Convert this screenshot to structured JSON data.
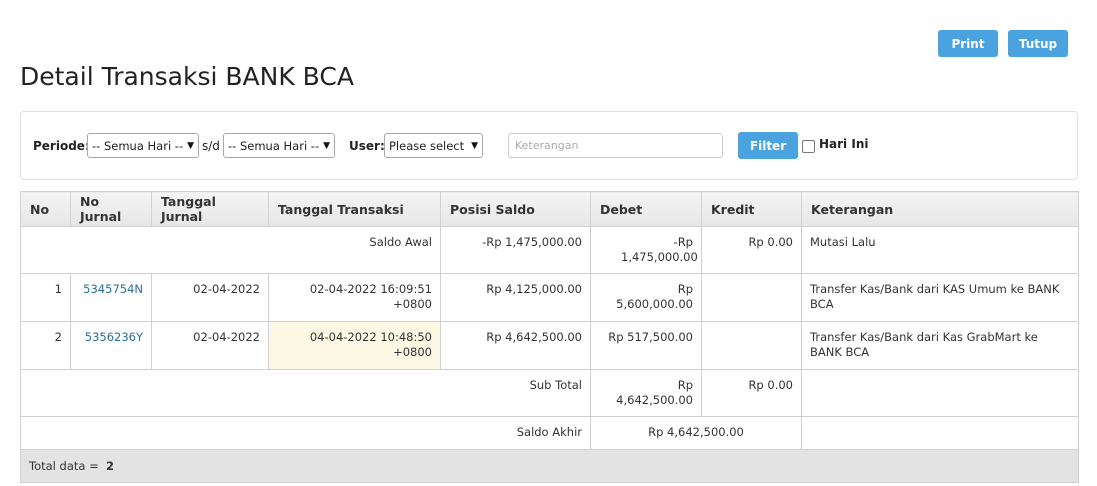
{
  "header": {
    "title": "Detail Transaksi BANK BCA",
    "print_label": "Print",
    "close_label": "Tutup"
  },
  "filters": {
    "periode_label": "Periode:",
    "start_value": "-- Semua Hari --",
    "sd_label": "s/d",
    "end_value": "-- Semua Hari --",
    "user_label": "User:",
    "user_value": "Please select",
    "keterangan_placeholder": "Keterangan",
    "filter_label": "Filter",
    "today_label": "Hari Ini"
  },
  "table": {
    "headers": [
      "No",
      "No Jurnal",
      "Tanggal Jurnal",
      "Tanggal Transaksi",
      "Posisi Saldo",
      "Debet",
      "Kredit",
      "Keterangan"
    ],
    "saldo_awal": {
      "label": "Saldo Awal",
      "posisi": "-Rp 1,475,000.00",
      "debet": "-Rp 1,475,000.00",
      "kredit": "Rp 0.00",
      "keterangan": "Mutasi Lalu"
    },
    "rows": [
      {
        "no": "1",
        "jurnal": "5345754N",
        "tgl_jurnal": "02-04-2022",
        "tgl_transaksi": "02-04-2022 16:09:51 +0800",
        "posisi": "Rp 4,125,000.00",
        "debet": "Rp 5,600,000.00",
        "kredit": "",
        "keterangan": "Transfer Kas/Bank dari KAS Umum ke BANK BCA"
      },
      {
        "no": "2",
        "jurnal": "5356236Y",
        "tgl_jurnal": "02-04-2022",
        "tgl_transaksi": "04-04-2022 10:48:50 +0800",
        "posisi": "Rp 4,642,500.00",
        "debet": "Rp 517,500.00",
        "kredit": "",
        "keterangan": "Transfer Kas/Bank dari Kas GrabMart ke BANK BCA"
      }
    ],
    "subtotal": {
      "label": "Sub Total",
      "debet": "Rp 4,642,500.00",
      "kredit": "Rp 0.00"
    },
    "saldo_akhir": {
      "label": "Saldo Akhir",
      "value": "Rp 4,642,500.00"
    },
    "total": {
      "label": "Total data =",
      "value": "2"
    }
  }
}
